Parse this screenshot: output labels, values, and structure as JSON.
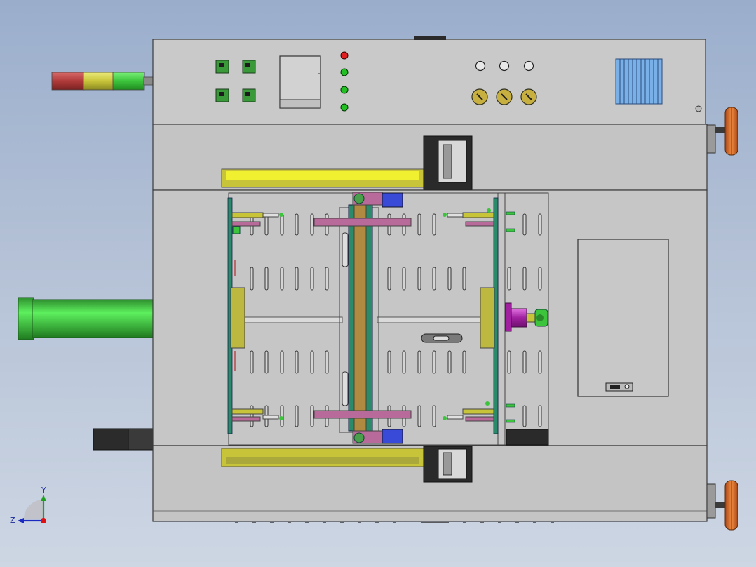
{
  "viewport": {
    "name": "cad-model-viewport"
  },
  "triad": {
    "y_label": "Y",
    "z_label": "Z"
  },
  "colors": {
    "machine_body": "#c8c8c8",
    "machine_edge": "#3a3a3a",
    "tower_red": "#b03a3a",
    "tower_yellow": "#c8c43a",
    "tower_green": "#3cc43c",
    "cylinder_green": "#3fd63f",
    "rail_yellow": "#e8e830",
    "rail_olive": "#c8c43a",
    "bracket_magenta": "#b86a9a",
    "motor_blue": "#3a4ad8",
    "handwheel_orange": "#e07030",
    "vent_blue": "#7ab0e8",
    "dark_block": "#2a2a2a"
  }
}
